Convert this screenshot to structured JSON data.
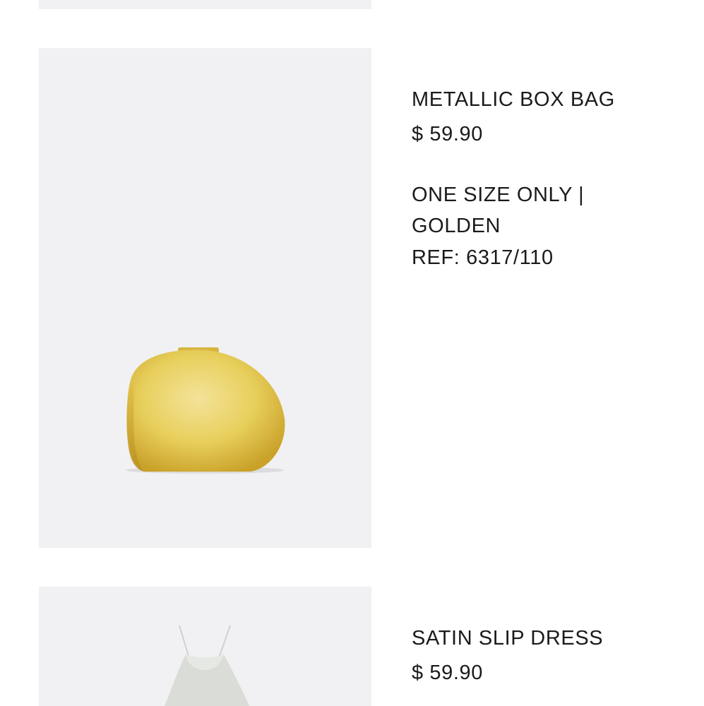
{
  "products": [
    {
      "name": "METALLIC BOX BAG",
      "price": "$ 59.90",
      "size_color": "ONE SIZE ONLY | GOLDEN",
      "ref": "REF: 6317/110",
      "image_icon": "golden-box-bag-image"
    },
    {
      "name": "SATIN SLIP DRESS",
      "price": "$ 59.90",
      "image_icon": "satin-slip-dress-image"
    }
  ],
  "colors": {
    "image_background": "#f1f1f3",
    "text": "#1b1b1b",
    "gold": "#e8cc55"
  }
}
